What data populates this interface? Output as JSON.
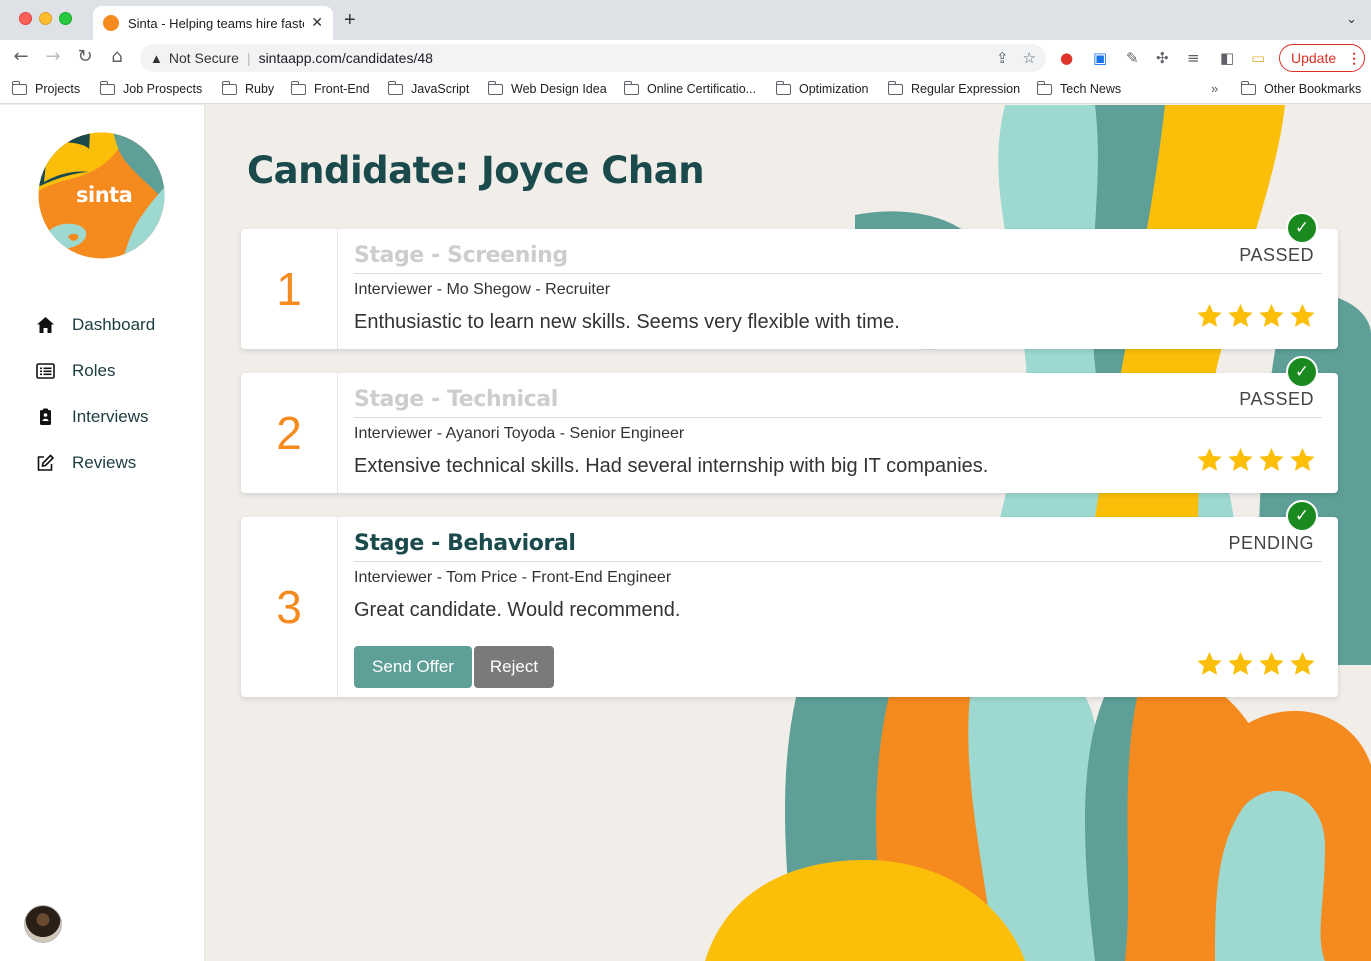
{
  "browser": {
    "tab_title": "Sinta - Helping teams hire faster",
    "tab_close": "✕",
    "new_tab": "+",
    "security_label": "Not Secure",
    "url": "sintaapp.com/candidates/48",
    "update_label": "Update",
    "update_menu": "⋮",
    "bookmarks": [
      "Projects",
      "Job Prospects",
      "Ruby",
      "Front-End",
      "JavaScript",
      "Web Design Idea",
      "Online Certificatio...",
      "Optimization",
      "Regular Expression",
      "Tech News"
    ],
    "bookmarks_overflow": "»",
    "other_bookmarks": "Other Bookmarks"
  },
  "sidebar": {
    "logo_text": "sinta",
    "items": [
      {
        "label": "Dashboard",
        "icon": "home-icon"
      },
      {
        "label": "Roles",
        "icon": "list-icon"
      },
      {
        "label": "Interviews",
        "icon": "clipboard-icon"
      },
      {
        "label": "Reviews",
        "icon": "edit-icon"
      }
    ]
  },
  "page": {
    "title": "Candidate: Joyce Chan"
  },
  "stages": [
    {
      "number": "1",
      "title": "Stage - Screening",
      "status": "PASSED",
      "interviewer": "Interviewer - Mo Shegow - Recruiter",
      "comment": "Enthusiastic to learn new skills. Seems very flexible with time.",
      "rating": 4,
      "check": "✓"
    },
    {
      "number": "2",
      "title": "Stage - Technical",
      "status": "PASSED",
      "interviewer": "Interviewer - Ayanori Toyoda - Senior Engineer",
      "comment": "Extensive technical skills. Had several internship with big IT companies.",
      "rating": 4,
      "check": "✓"
    },
    {
      "number": "3",
      "title": "Stage - Behavioral",
      "status": "PENDING",
      "interviewer": "Interviewer - Tom Price - Front-End Engineer",
      "comment": "Great candidate. Would recommend.",
      "rating": 4,
      "check": "✓",
      "actions": {
        "send_offer": "Send Offer",
        "reject": "Reject"
      }
    }
  ],
  "colors": {
    "accent_orange": "#f58a1f",
    "teal": "#5e9f98",
    "light_teal": "#9dd9d1",
    "yellow": "#fbbf0a",
    "title_dark": "#1b4a4c",
    "check_green": "#1a8a1f"
  }
}
